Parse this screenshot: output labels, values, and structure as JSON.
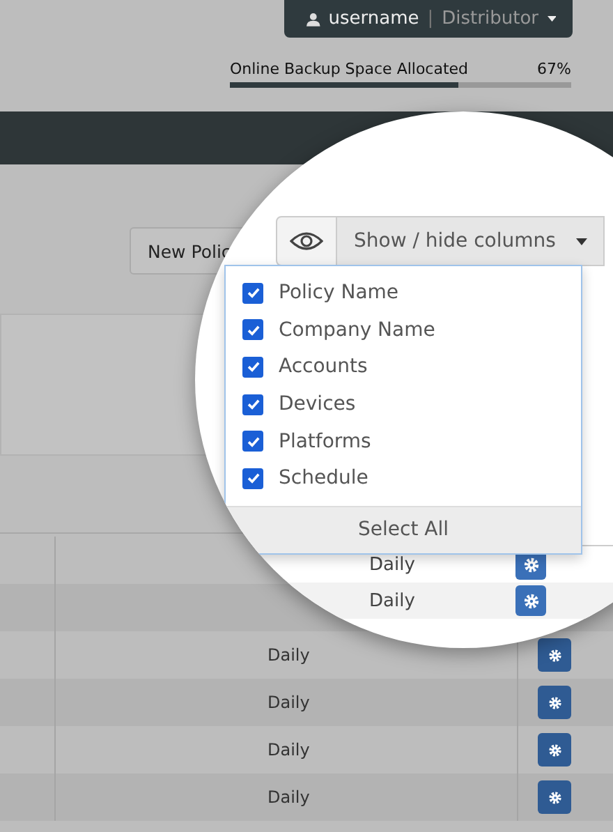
{
  "user_menu": {
    "username": "username",
    "separator": "|",
    "role": "Distributor"
  },
  "storage": {
    "label": "Online Backup Space Allocated",
    "reading": "67%",
    "level": 0.67
  },
  "new_policy_button": "New Polic",
  "column_picker": {
    "button": "Show / hide columns",
    "options": [
      {
        "label": "Policy Name",
        "checked": true
      },
      {
        "label": "Company Name",
        "checked": true
      },
      {
        "label": "Accounts",
        "checked": true
      },
      {
        "label": "Devices",
        "checked": true
      },
      {
        "label": "Platforms",
        "checked": true
      },
      {
        "label": "Schedule",
        "checked": true
      }
    ],
    "select_all": "Select All"
  },
  "magnified_rows": [
    {
      "schedule": "Daily"
    },
    {
      "schedule": "Daily"
    }
  ],
  "table": {
    "rows": [
      {
        "schedule": "Daily"
      },
      {
        "schedule": "Daily"
      },
      {
        "schedule": "Daily"
      },
      {
        "schedule": "Daily"
      }
    ]
  }
}
